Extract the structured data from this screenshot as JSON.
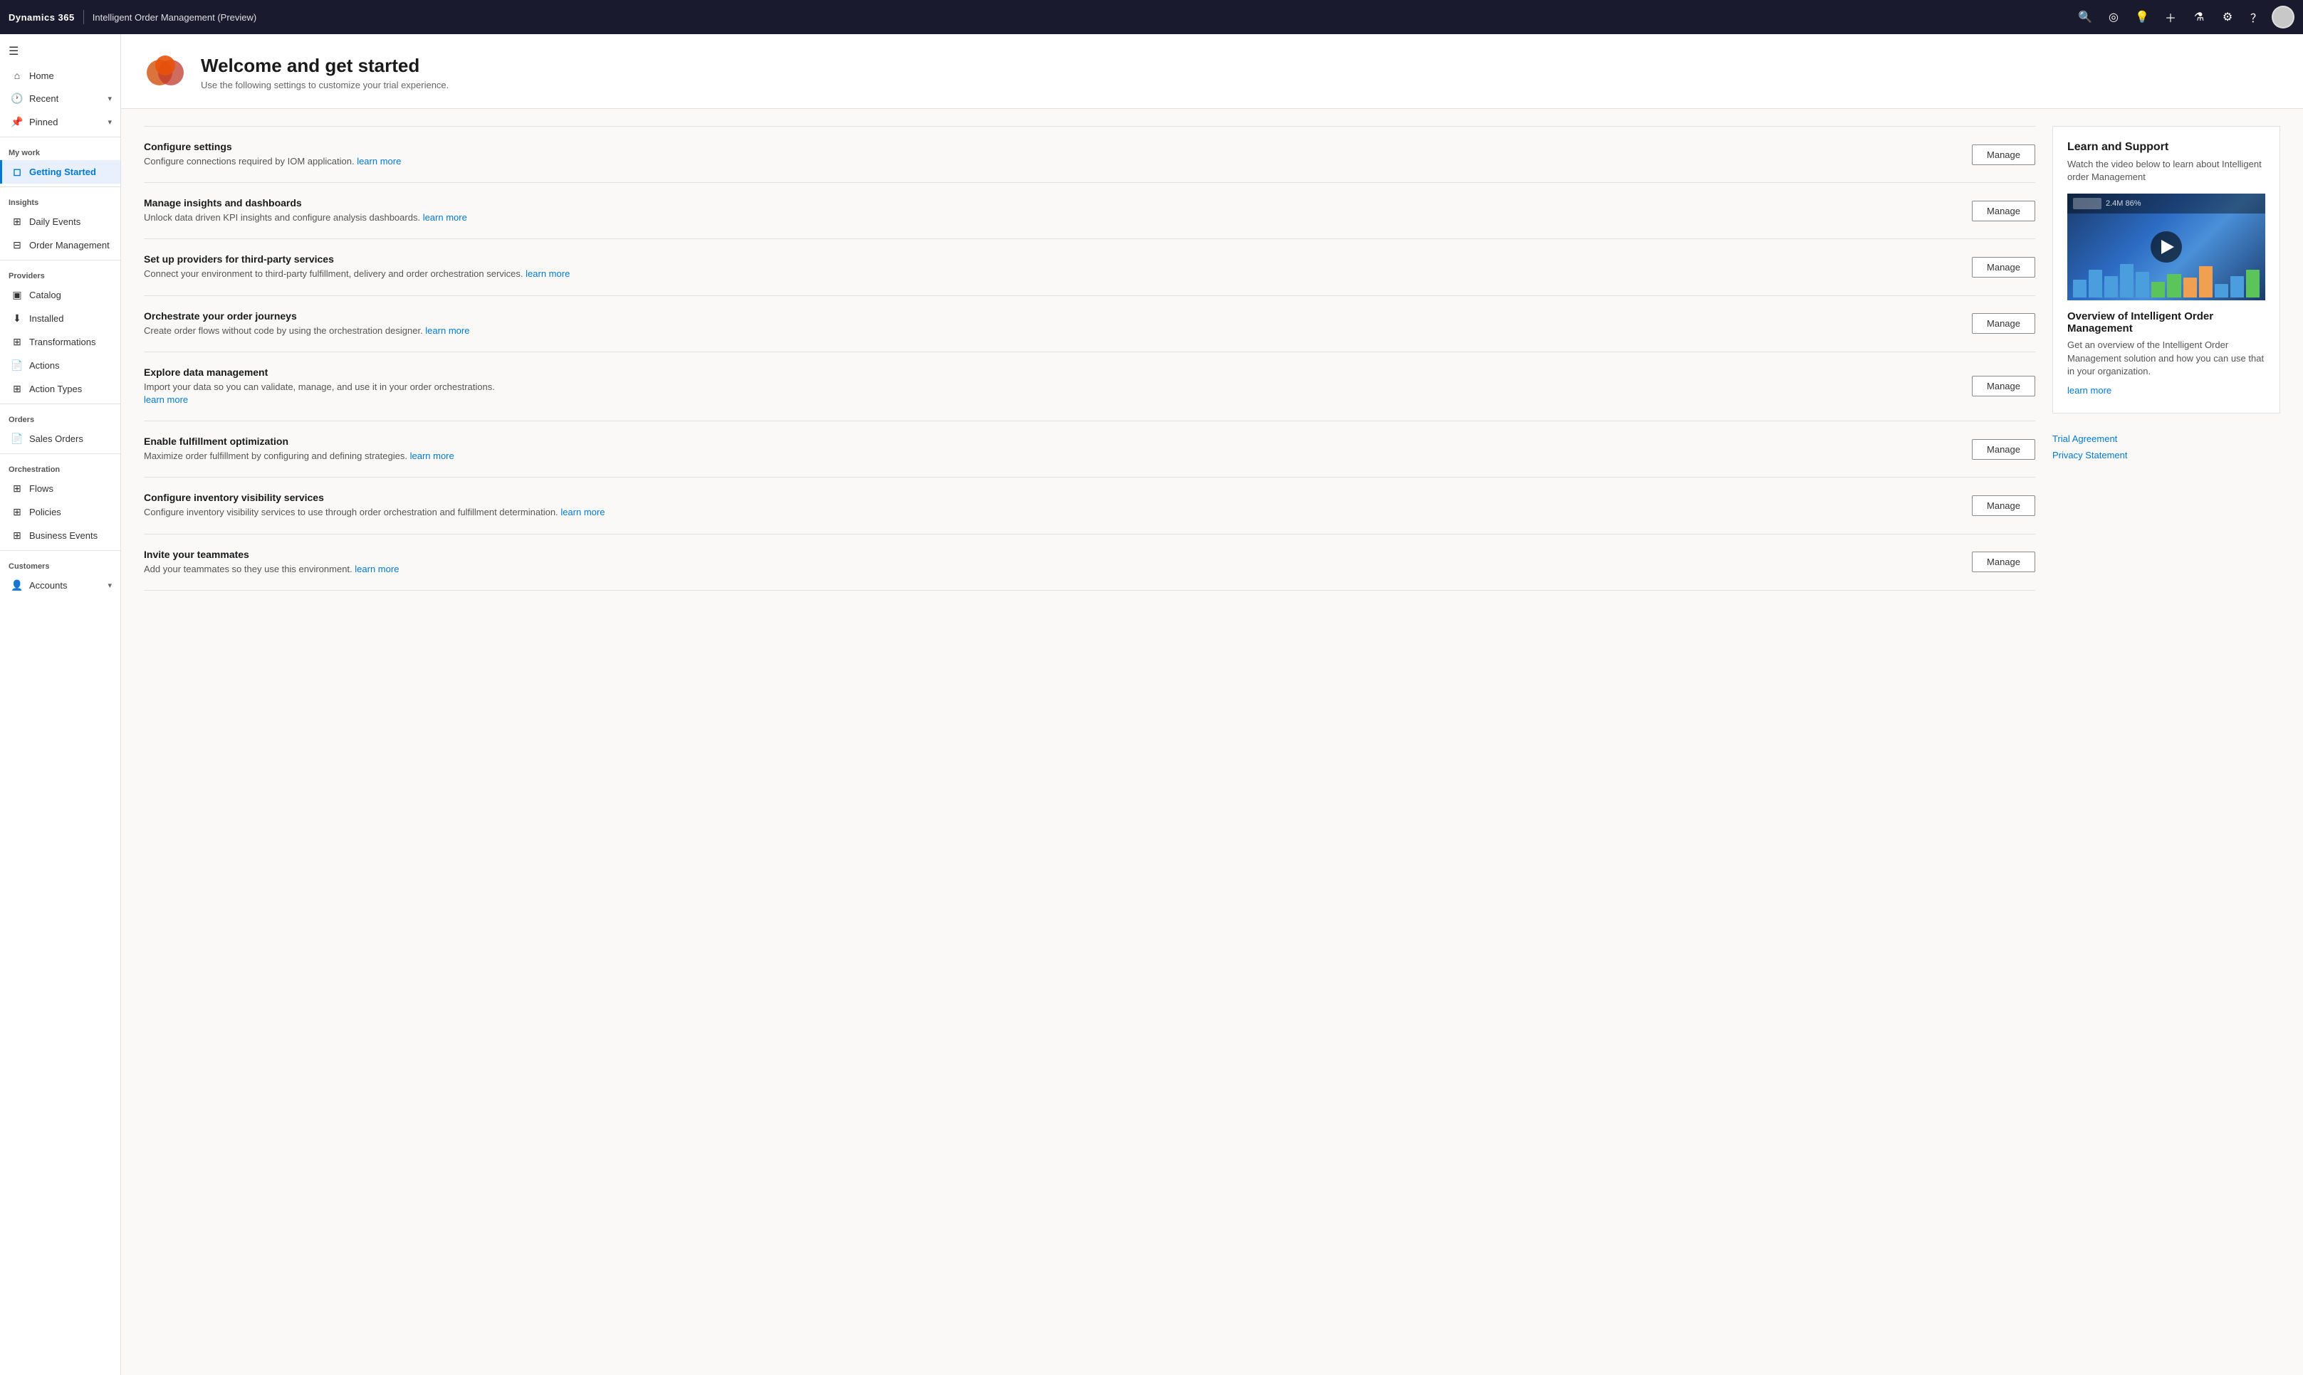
{
  "topbar": {
    "brand": "Dynamics 365",
    "app_name": "Intelligent Order Management (Preview)"
  },
  "sidebar": {
    "hamburger_label": "☰",
    "nav": [
      {
        "id": "home",
        "label": "Home",
        "icon": "⌂",
        "section": null,
        "active": false
      },
      {
        "id": "recent",
        "label": "Recent",
        "icon": "🕐",
        "section": null,
        "active": false,
        "chevron": "▾"
      },
      {
        "id": "pinned",
        "label": "Pinned",
        "icon": "📌",
        "section": null,
        "active": false,
        "chevron": "▾"
      },
      {
        "id": "my-work",
        "label": "My work",
        "section_label": true
      },
      {
        "id": "getting-started",
        "label": "Getting Started",
        "icon": "◻",
        "section": "my-work",
        "active": true
      },
      {
        "id": "insights",
        "label": "Insights",
        "section_label": true
      },
      {
        "id": "daily-events",
        "label": "Daily Events",
        "icon": "⊞",
        "section": "insights",
        "active": false
      },
      {
        "id": "order-management",
        "label": "Order Management",
        "icon": "⊟",
        "section": "insights",
        "active": false
      },
      {
        "id": "providers",
        "label": "Providers",
        "section_label": true
      },
      {
        "id": "catalog",
        "label": "Catalog",
        "icon": "▣",
        "section": "providers",
        "active": false
      },
      {
        "id": "installed",
        "label": "Installed",
        "icon": "⬇",
        "section": "providers",
        "active": false
      },
      {
        "id": "transformations",
        "label": "Transformations",
        "icon": "⊞",
        "section": "providers",
        "active": false
      },
      {
        "id": "actions",
        "label": "Actions",
        "icon": "📄",
        "section": "providers",
        "active": false
      },
      {
        "id": "action-types",
        "label": "Action Types",
        "icon": "⊞",
        "section": "providers",
        "active": false
      },
      {
        "id": "orders",
        "label": "Orders",
        "section_label": true
      },
      {
        "id": "sales-orders",
        "label": "Sales Orders",
        "icon": "📄",
        "section": "orders",
        "active": false
      },
      {
        "id": "orchestration",
        "label": "Orchestration",
        "section_label": true
      },
      {
        "id": "flows",
        "label": "Flows",
        "icon": "⊞",
        "section": "orchestration",
        "active": false
      },
      {
        "id": "policies",
        "label": "Policies",
        "icon": "⊞",
        "section": "orchestration",
        "active": false
      },
      {
        "id": "business-events",
        "label": "Business Events",
        "icon": "⊞",
        "section": "orchestration",
        "active": false
      },
      {
        "id": "customers",
        "label": "Customers",
        "section_label": true
      },
      {
        "id": "accounts",
        "label": "Accounts",
        "icon": "👤",
        "section": "customers",
        "active": false
      }
    ]
  },
  "page": {
    "title": "Welcome and get started",
    "subtitle": "Use the following settings to customize your trial experience."
  },
  "getting_started_items": [
    {
      "id": "configure-settings",
      "title": "Configure settings",
      "desc": "Configure connections required by IOM application.",
      "link_text": "learn more",
      "button_label": "Manage"
    },
    {
      "id": "manage-insights",
      "title": "Manage insights and dashboards",
      "desc": "Unlock data driven KPI insights and configure analysis dashboards.",
      "link_text": "learn more",
      "button_label": "Manage"
    },
    {
      "id": "setup-providers",
      "title": "Set up providers for third-party services",
      "desc": "Connect your environment to third-party fulfillment, delivery and order orchestration services.",
      "link_text": "learn more",
      "button_label": "Manage"
    },
    {
      "id": "orchestrate-journeys",
      "title": "Orchestrate your order journeys",
      "desc": "Create order flows without code by using the orchestration designer.",
      "link_text": "learn more",
      "button_label": "Manage"
    },
    {
      "id": "explore-data",
      "title": "Explore data management",
      "desc": "Import your data so you can validate, manage, and use it in your order orchestrations.",
      "link_text": "learn more",
      "button_label": "Manage"
    },
    {
      "id": "enable-fulfillment",
      "title": "Enable fulfillment optimization",
      "desc": "Maximize order fulfillment by configuring and defining strategies.",
      "link_text": "learn more",
      "button_label": "Manage"
    },
    {
      "id": "configure-inventory",
      "title": "Configure inventory visibility services",
      "desc": "Configure inventory visibility services to use through order orchestration and fulfillment determination.",
      "link_text": "learn more",
      "button_label": "Manage"
    },
    {
      "id": "invite-teammates",
      "title": "Invite your teammates",
      "desc": "Add your teammates so they use this environment.",
      "link_text": "learn more",
      "button_label": "Manage"
    }
  ],
  "support_panel": {
    "title": "Learn and Support",
    "desc": "Watch the video below to learn about Intelligent order Management",
    "video_title": "Overview of Intelligent Order Management",
    "video_desc": "Get an overview of the Intelligent Order Management solution and how you can use that in your organization.",
    "video_link_text": "learn more",
    "trial_agreement_label": "Trial Agreement",
    "privacy_statement_label": "Privacy Statement"
  }
}
